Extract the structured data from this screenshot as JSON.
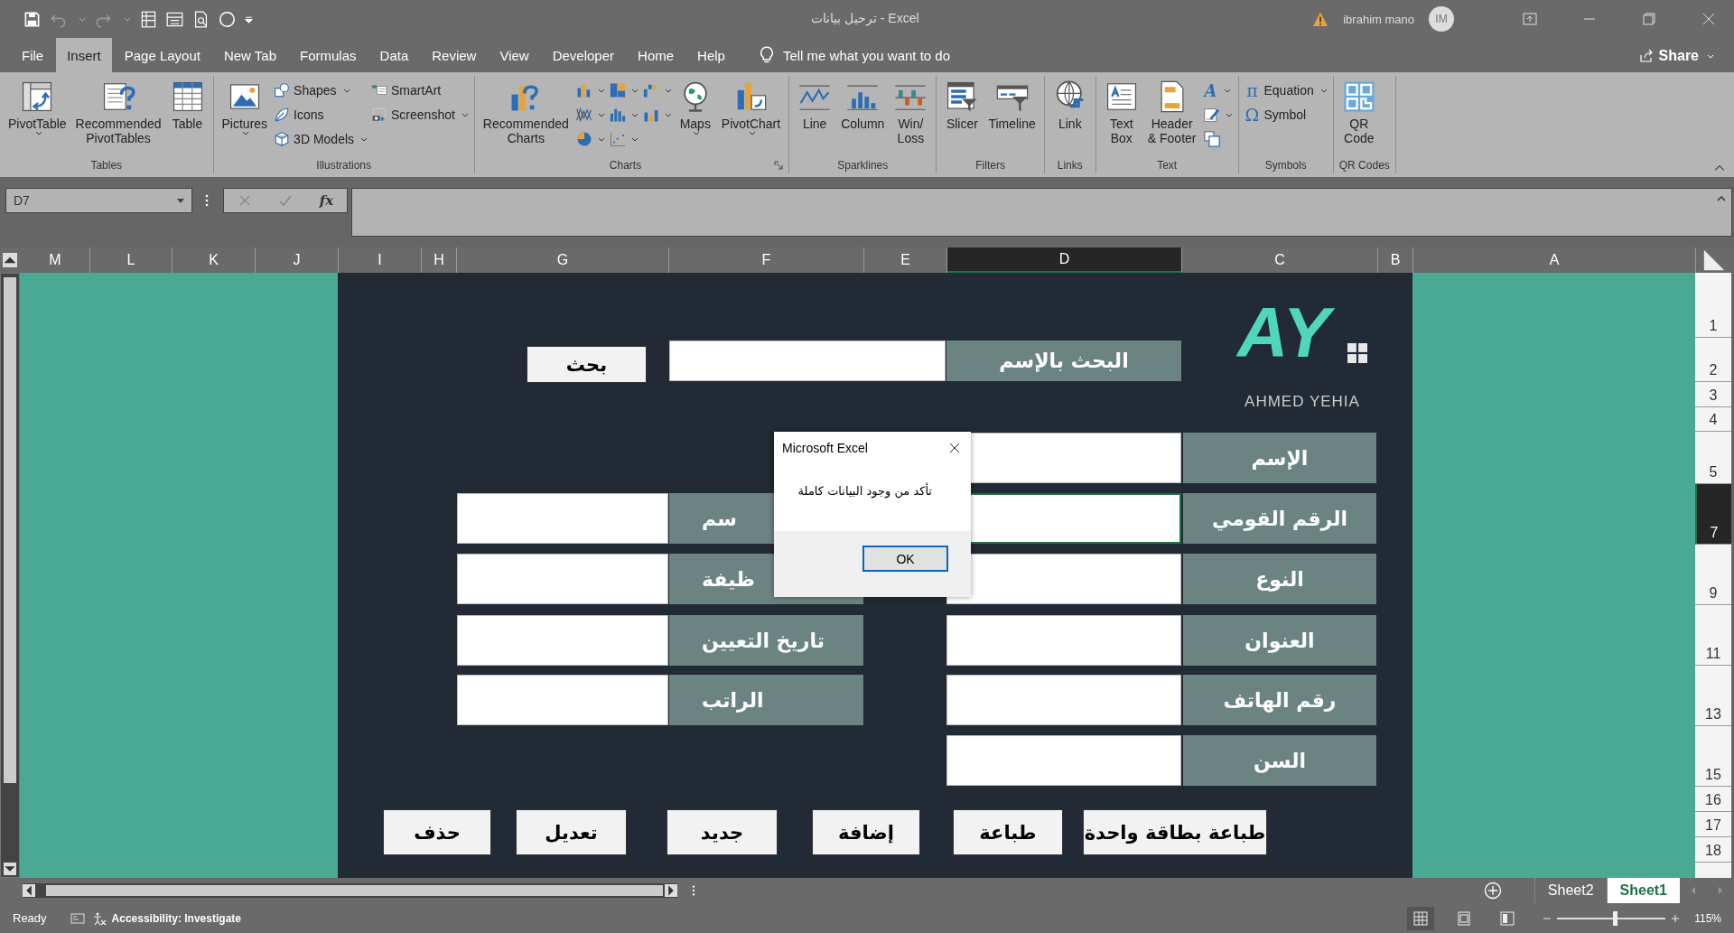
{
  "title_bar": {
    "title": "ترحيل بيانات - Excel",
    "user": "ibrahim mano",
    "avatar": "IM"
  },
  "menu_tabs": [
    {
      "label": "File",
      "selected": false
    },
    {
      "label": "Insert",
      "selected": true
    },
    {
      "label": "Page Layout",
      "selected": false
    },
    {
      "label": "New Tab",
      "selected": false
    },
    {
      "label": "Formulas",
      "selected": false
    },
    {
      "label": "Data",
      "selected": false
    },
    {
      "label": "Review",
      "selected": false
    },
    {
      "label": "View",
      "selected": false
    },
    {
      "label": "Developer",
      "selected": false
    },
    {
      "label": "Home",
      "selected": false
    },
    {
      "label": "Help",
      "selected": false
    }
  ],
  "tell_me": "Tell me what you want to do",
  "share": "Share",
  "ribbon_groups": [
    {
      "name": "Tables",
      "launcher": false,
      "columns": [
        [
          {
            "kind": "large",
            "label": "PivotTable",
            "dropdown": true
          }
        ],
        [
          {
            "kind": "large",
            "label": "Recommended\nPivotTables",
            "dropdown": false
          }
        ],
        [
          {
            "kind": "large",
            "label": "Table",
            "dropdown": false
          }
        ]
      ]
    },
    {
      "name": "Illustrations",
      "launcher": false,
      "columns": [
        [
          {
            "kind": "large",
            "label": "Pictures",
            "dropdown": true
          }
        ],
        [
          {
            "kind": "small",
            "label": "Shapes",
            "dropdown": true
          },
          {
            "kind": "small",
            "label": "Icons",
            "dropdown": false
          },
          {
            "kind": "small",
            "label": "3D Models",
            "dropdown": true
          }
        ],
        [
          {
            "kind": "small",
            "label": "SmartArt",
            "dropdown": false
          },
          {
            "kind": "small",
            "label": "Screenshot",
            "dropdown": true
          }
        ]
      ]
    },
    {
      "name": "Charts",
      "launcher": true,
      "columns": [
        [
          {
            "kind": "large",
            "label": "Recommended\nCharts",
            "dropdown": false
          }
        ],
        [
          {
            "kind": "icon",
            "dropdown": true
          },
          {
            "kind": "icon",
            "dropdown": true
          },
          {
            "kind": "icon",
            "dropdown": true
          }
        ],
        [
          {
            "kind": "icon",
            "dropdown": true
          },
          {
            "kind": "icon",
            "dropdown": true
          },
          {
            "kind": "icon",
            "dropdown": true
          }
        ],
        [
          {
            "kind": "icon",
            "dropdown": true
          },
          {
            "kind": "icon",
            "dropdown": true
          }
        ],
        [
          {
            "kind": "large",
            "label": "Maps",
            "dropdown": true
          }
        ],
        [
          {
            "kind": "large",
            "label": "PivotChart",
            "dropdown": true
          }
        ]
      ]
    },
    {
      "name": "Sparklines",
      "launcher": false,
      "columns": [
        [
          {
            "kind": "large",
            "label": "Line",
            "dropdown": false
          }
        ],
        [
          {
            "kind": "large",
            "label": "Column",
            "dropdown": false
          }
        ],
        [
          {
            "kind": "large",
            "label": "Win/\nLoss",
            "dropdown": false
          }
        ]
      ]
    },
    {
      "name": "Filters",
      "launcher": false,
      "columns": [
        [
          {
            "kind": "large",
            "label": "Slicer",
            "dropdown": false
          }
        ],
        [
          {
            "kind": "large",
            "label": "Timeline",
            "dropdown": false
          }
        ]
      ]
    },
    {
      "name": "Links",
      "launcher": false,
      "columns": [
        [
          {
            "kind": "large",
            "label": "Link",
            "dropdown": false
          }
        ]
      ]
    },
    {
      "name": "Text",
      "launcher": false,
      "columns": [
        [
          {
            "kind": "large",
            "label": "Text\nBox",
            "dropdown": false
          }
        ],
        [
          {
            "kind": "large",
            "label": "Header\n& Footer",
            "dropdown": false
          }
        ],
        [
          {
            "kind": "icon",
            "glyph": "A",
            "dropdown": true
          },
          {
            "kind": "icon",
            "dropdown": true
          },
          {
            "kind": "icon",
            "dropdown": false
          }
        ]
      ]
    },
    {
      "name": "Symbols",
      "launcher": false,
      "columns": [
        [
          {
            "kind": "small",
            "glyph": "π",
            "label": "Equation",
            "dropdown": true
          },
          {
            "kind": "small",
            "glyph": "Ω",
            "label": "Symbol",
            "dropdown": false
          }
        ]
      ]
    },
    {
      "name": "QR Codes",
      "launcher": false,
      "columns": [
        [
          {
            "kind": "large",
            "label": "QR\nCode",
            "dropdown": false
          }
        ]
      ]
    }
  ],
  "formula_bar": {
    "name_box": "D7",
    "fx": "fx"
  },
  "columns": [
    {
      "label": "M",
      "selected": false
    },
    {
      "label": "L",
      "selected": false
    },
    {
      "label": "K",
      "selected": false
    },
    {
      "label": "J",
      "selected": false
    },
    {
      "label": "I",
      "selected": false
    },
    {
      "label": "H",
      "selected": false
    },
    {
      "label": "G",
      "selected": false
    },
    {
      "label": "F",
      "selected": false
    },
    {
      "label": "E",
      "selected": false
    },
    {
      "label": "D",
      "selected": true
    },
    {
      "label": "C",
      "selected": false
    },
    {
      "label": "B",
      "selected": false
    },
    {
      "label": "A",
      "selected": false
    }
  ],
  "rows": [
    {
      "label": "1",
      "selected": false
    },
    {
      "label": "2",
      "selected": false
    },
    {
      "label": "3",
      "selected": false
    },
    {
      "label": "4",
      "selected": false
    },
    {
      "label": "5",
      "selected": false
    },
    {
      "label": "7",
      "selected": true
    },
    {
      "label": "9",
      "selected": false
    },
    {
      "label": "11",
      "selected": false
    },
    {
      "label": "13",
      "selected": false
    },
    {
      "label": "15",
      "selected": false
    },
    {
      "label": "16",
      "selected": false
    },
    {
      "label": "17",
      "selected": false
    },
    {
      "label": "18",
      "selected": false
    }
  ],
  "form": {
    "logo": {
      "mark": "AY",
      "name": "AHMED YEHIA"
    },
    "search": {
      "label": "البحث بالإسم",
      "button": "بحث"
    },
    "right_fields": [
      {
        "label": "الإسم",
        "active": false
      },
      {
        "label": "الرقم القومي",
        "active": true
      },
      {
        "label": "النوع",
        "active": false
      },
      {
        "label": "العنوان",
        "active": false
      },
      {
        "label": "رقم الهاتف",
        "active": false
      },
      {
        "label": "السن",
        "active": false
      }
    ],
    "left_fields": [
      {
        "label": "سم"
      },
      {
        "label": "ظيفة"
      },
      {
        "label": "تاريخ التعيين"
      },
      {
        "label": "الراتب"
      }
    ],
    "buttons": [
      "طباعة بطاقة واحدة",
      "طباعة",
      "إضافة",
      "جديد",
      "تعديل",
      "حذف"
    ]
  },
  "dialog": {
    "title": "Microsoft Excel",
    "message": "تأكد من وجود البيانات كاملة",
    "button": "OK"
  },
  "sheet_tabs": [
    {
      "label": "Sheet2",
      "selected": false
    },
    {
      "label": "Sheet1",
      "selected": true
    }
  ],
  "status_bar": {
    "ready": "Ready",
    "accessibility": "Accessibility: Investigate",
    "views": [
      {
        "selected": true
      },
      {
        "selected": false
      },
      {
        "selected": false
      }
    ],
    "zoom_slider": {
      "level": 0.53
    },
    "zoom": "115%"
  }
}
